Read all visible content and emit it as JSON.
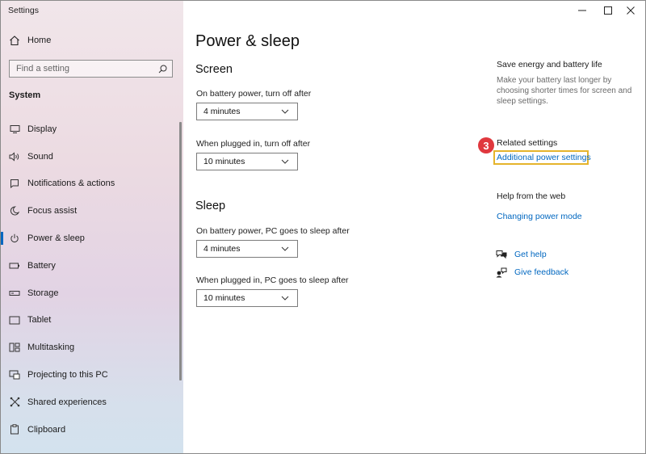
{
  "window": {
    "title": "Settings",
    "controls": [
      "minimize-icon",
      "maximize-icon",
      "close-icon"
    ]
  },
  "sidebar": {
    "home_label": "Home",
    "search_placeholder": "Find a setting",
    "section_title": "System",
    "items": [
      {
        "label": "Display",
        "icon": "display-icon"
      },
      {
        "label": "Sound",
        "icon": "speaker-icon"
      },
      {
        "label": "Notifications & actions",
        "icon": "notification-icon"
      },
      {
        "label": "Focus assist",
        "icon": "moon-icon"
      },
      {
        "label": "Power & sleep",
        "icon": "power-icon",
        "active": true
      },
      {
        "label": "Battery",
        "icon": "battery-icon"
      },
      {
        "label": "Storage",
        "icon": "storage-icon"
      },
      {
        "label": "Tablet",
        "icon": "tablet-icon"
      },
      {
        "label": "Multitasking",
        "icon": "multitasking-icon"
      },
      {
        "label": "Projecting to this PC",
        "icon": "projector-icon"
      },
      {
        "label": "Shared experiences",
        "icon": "shared-icon"
      },
      {
        "label": "Clipboard",
        "icon": "clipboard-icon"
      }
    ]
  },
  "main": {
    "title": "Power & sleep",
    "screen": {
      "title": "Screen",
      "battery_label": "On battery power, turn off after",
      "battery_value": "4 minutes",
      "plugged_label": "When plugged in, turn off after",
      "plugged_value": "10 minutes"
    },
    "sleep": {
      "title": "Sleep",
      "battery_label": "On battery power, PC goes to sleep after",
      "battery_value": "4 minutes",
      "plugged_label": "When plugged in, PC goes to sleep after",
      "plugged_value": "10 minutes"
    }
  },
  "right": {
    "energy_title": "Save energy and battery life",
    "energy_desc": "Make your battery last longer by choosing shorter times for screen and sleep settings.",
    "related_title": "Related settings",
    "related_link": "Additional power settings",
    "step_badge": "3",
    "help_title": "Help from the web",
    "help_link": "Changing power mode",
    "get_help": "Get help",
    "give_feedback": "Give feedback"
  },
  "colors": {
    "accent": "#0067c0",
    "highlight": "#e5b42c",
    "badge": "#e0383e"
  }
}
